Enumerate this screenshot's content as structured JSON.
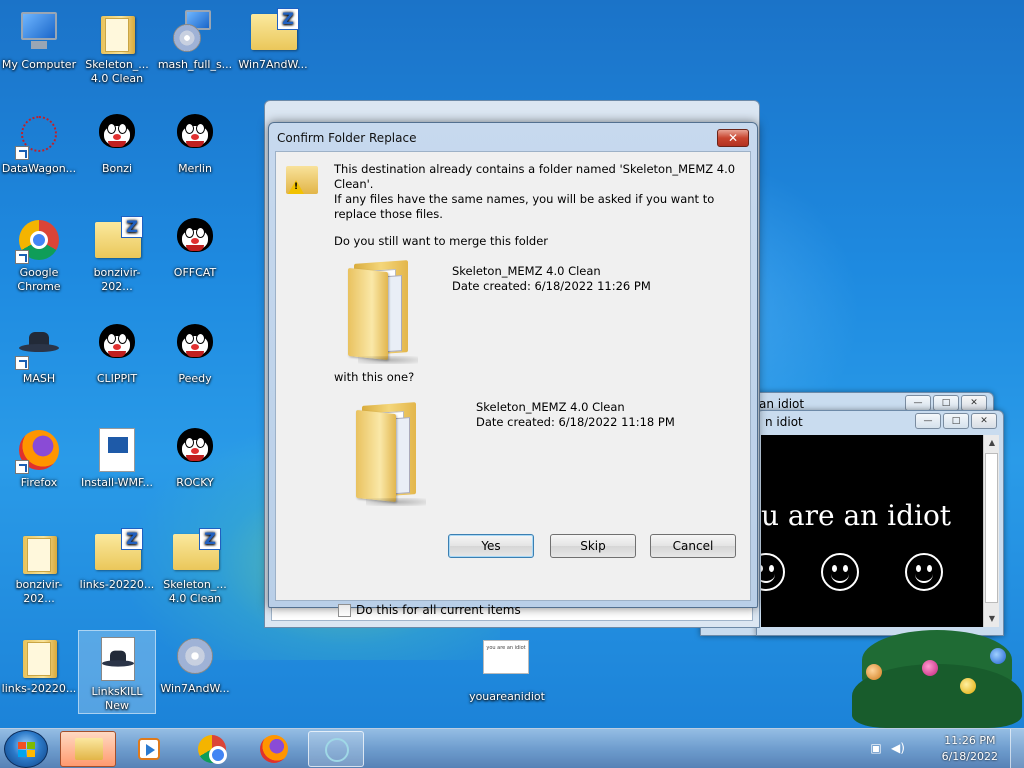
{
  "desktop": {
    "icons": [
      {
        "label": "My Computer"
      },
      {
        "label": "Skeleton_... 4.0 Clean"
      },
      {
        "label": "mash_full_s..."
      },
      {
        "label": "Win7AndW..."
      },
      {
        "label": "DataWagon..."
      },
      {
        "label": "Bonzi"
      },
      {
        "label": "Merlin"
      },
      {
        "label": "Google Chrome"
      },
      {
        "label": "bonzivir-202..."
      },
      {
        "label": "OFFCAT"
      },
      {
        "label": "MASH"
      },
      {
        "label": "CLIPPIT"
      },
      {
        "label": "Peedy"
      },
      {
        "label": "Firefox"
      },
      {
        "label": "Install-WMF..."
      },
      {
        "label": "ROCKY"
      },
      {
        "label": "bonzivir-202..."
      },
      {
        "label": "links-20220..."
      },
      {
        "label": "Skeleton_... 4.0 Clean"
      },
      {
        "label": "links-20220..."
      },
      {
        "label": "LinksKILL New"
      },
      {
        "label": "Win7AndW..."
      },
      {
        "label": "youareanidiot"
      }
    ]
  },
  "idiot_windows": {
    "back_title": "an idiot",
    "front_title": "n idiot",
    "message": "u are an idiot",
    "thumb_text": "you are an idiot"
  },
  "dialog": {
    "title": "Confirm Folder Replace",
    "line1": "This destination already contains a folder named 'Skeleton_MEMZ 4.0 Clean'.",
    "line2": "If any files have the same names, you will be asked if you want to replace those files.",
    "line3": "Do you still want to merge this folder",
    "folder1_name": "Skeleton_MEMZ 4.0 Clean",
    "folder1_date": "Date created: 6/18/2022 11:26 PM",
    "with_text": "with this one?",
    "folder2_name": "Skeleton_MEMZ 4.0 Clean",
    "folder2_date": "Date created: 6/18/2022 11:18 PM",
    "yes_label": "Yes",
    "skip_label": "Skip",
    "cancel_label": "Cancel",
    "checkbox_label": "Do this for all current items",
    "checkbox_checked": false
  },
  "taskbar": {
    "items": [
      "start-button",
      "explorer-icon",
      "media-player-icon",
      "chrome-icon",
      "firefox-icon",
      "electron-app-icon"
    ],
    "clock_time": "11:26 PM",
    "clock_date": "6/18/2022"
  }
}
